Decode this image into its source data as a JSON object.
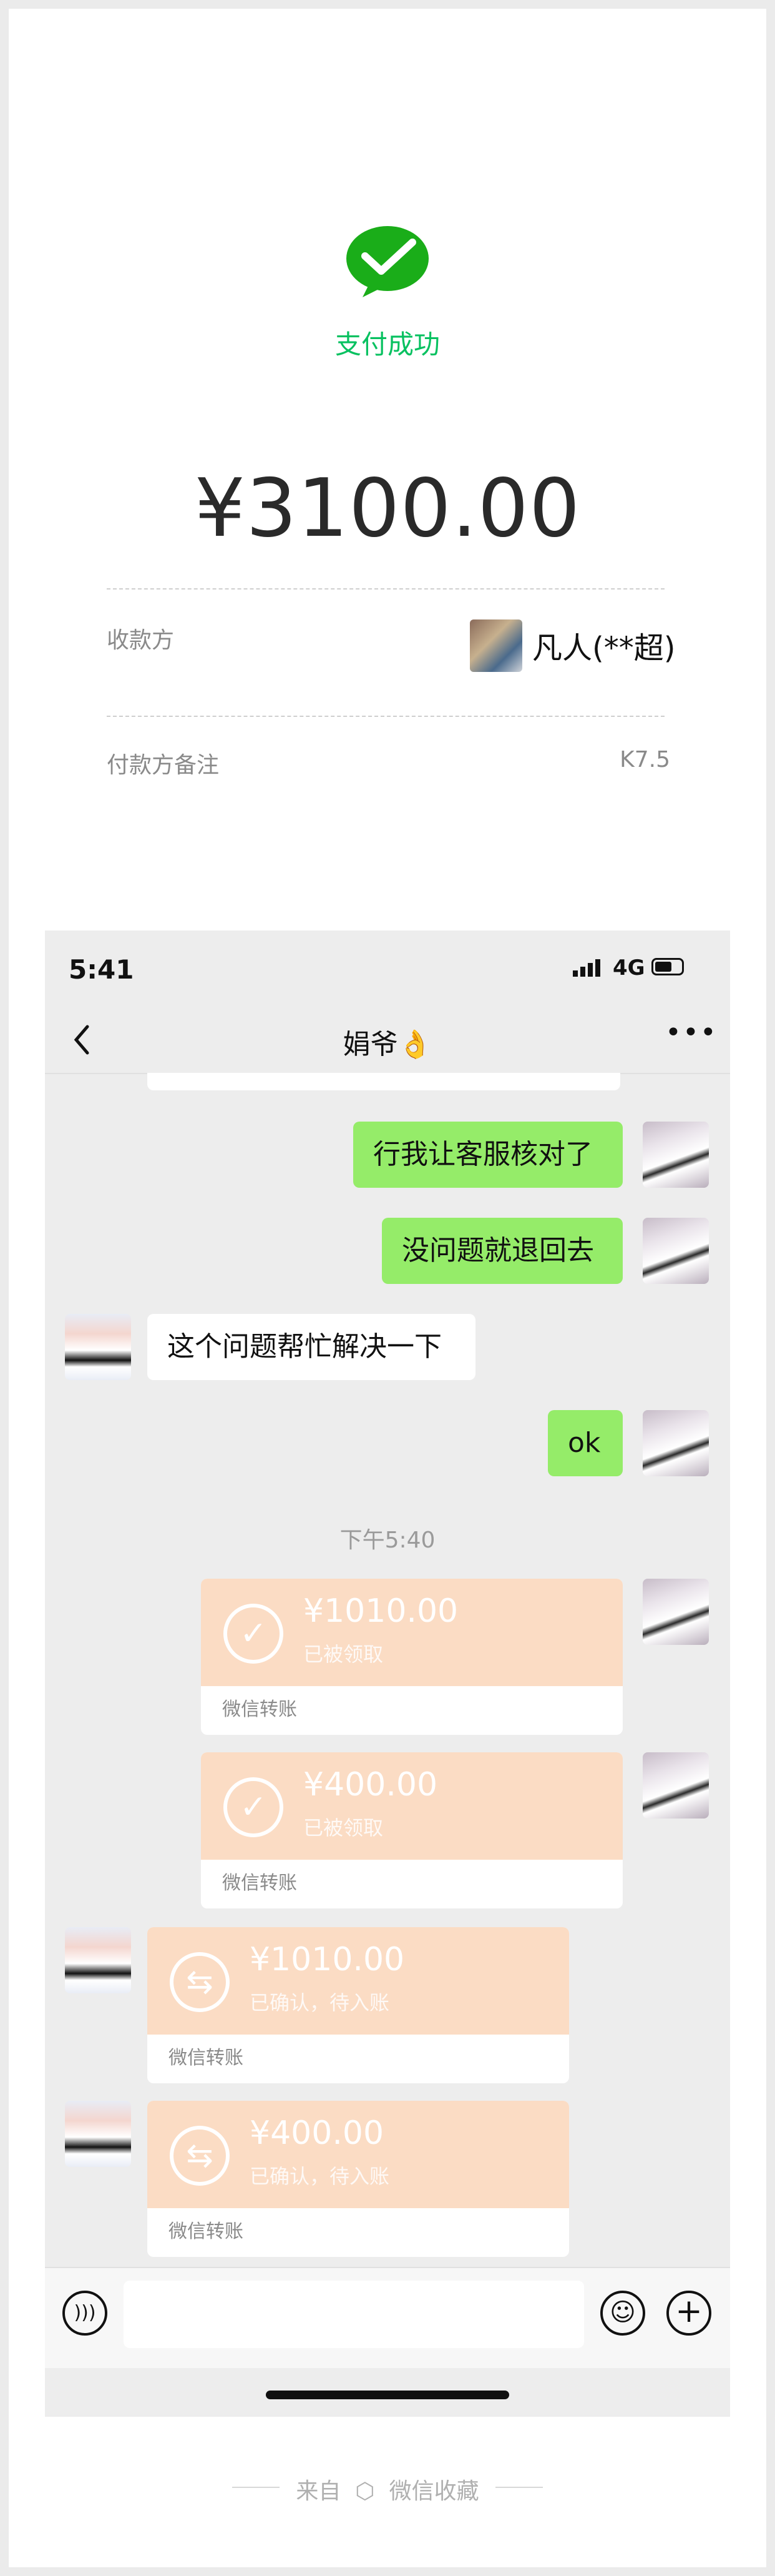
{
  "payment": {
    "status": "支付成功",
    "amount": "¥3100.00",
    "payee_label": "收款方",
    "payee_name": "凡人(**超)",
    "remark_label": "付款方备注",
    "remark_value": "K7.5"
  },
  "phone": {
    "time": "5:41",
    "network": "4G",
    "chat_title": "娟爷👌",
    "back_icon": "chevron-left-icon",
    "more_icon": "ellipsis-icon"
  },
  "messages": {
    "m1": "行我让客服核对了",
    "m2": "没问题就退回去",
    "m3": "这个问题帮忙解决一下",
    "m4": "ok",
    "timestamp": "下午5:40"
  },
  "transfers": [
    {
      "amount": "¥1010.00",
      "status": "已被领取",
      "footer": "微信转账"
    },
    {
      "amount": "¥400.00",
      "status": "已被领取",
      "footer": "微信转账"
    },
    {
      "amount": "¥1010.00",
      "status": "已确认，待入账",
      "footer": "微信转账"
    },
    {
      "amount": "¥400.00",
      "status": "已确认，待入账",
      "footer": "微信转账"
    }
  ],
  "source": {
    "prefix": "来自",
    "name": "微信收藏"
  },
  "colors": {
    "wechat_green": "#07c160",
    "bubble_green": "#95ec69",
    "transfer_orange": "#fbdcc4"
  }
}
